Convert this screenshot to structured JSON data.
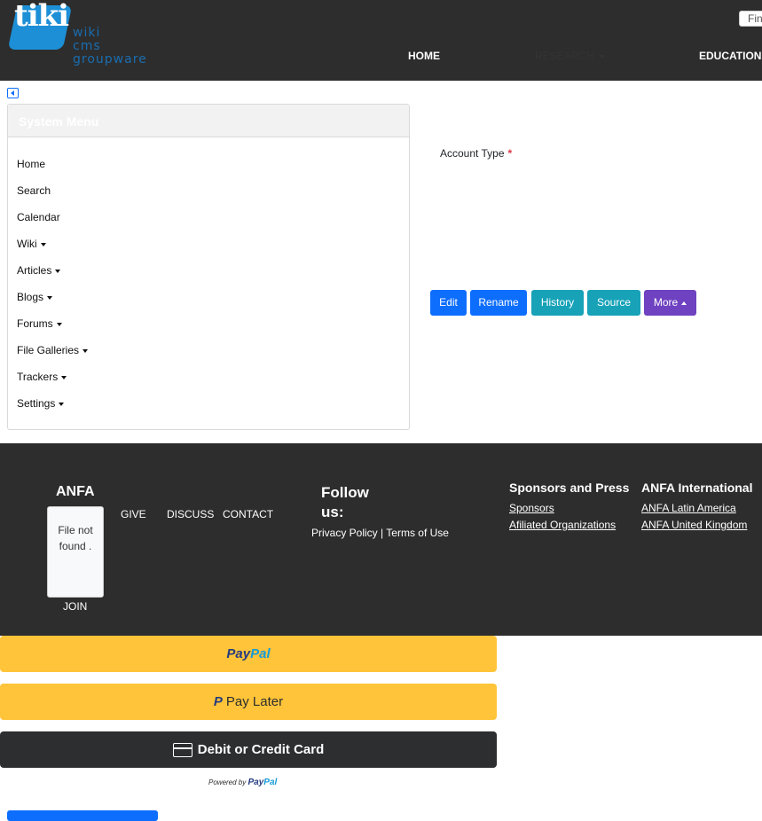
{
  "header": {
    "logo": "tiki",
    "logo_subtitle_lines": [
      "wiki",
      "cms",
      "groupware"
    ],
    "nav": {
      "home": "HOME",
      "research": "RESEARCH",
      "education": "EDUCATION"
    },
    "find_placeholder": "Fin"
  },
  "system_menu": {
    "title": "System Menu",
    "items": [
      {
        "label": "Home"
      },
      {
        "label": "Search"
      },
      {
        "label": "Calendar"
      },
      {
        "label": "Wiki"
      },
      {
        "label": "Articles"
      },
      {
        "label": "Blogs"
      },
      {
        "label": "Forums"
      },
      {
        "label": "File Galleries"
      },
      {
        "label": "Trackers"
      },
      {
        "label": "Settings"
      }
    ]
  },
  "content": {
    "account_type_label": "Account Type",
    "required_mark": "*",
    "buttons": {
      "edit": "Edit",
      "rename": "Rename",
      "history": "History",
      "source": "Source",
      "more": "More"
    }
  },
  "footer": {
    "anfa": "ANFA",
    "file_not_found": "File not found .",
    "join": "JOIN",
    "give": "GIVE",
    "discuss": "DISCUSS",
    "contact": "CONTACT",
    "follow_us": "Follow us:",
    "privacy_policy": "Privacy Policy",
    "separator": "|",
    "terms_of_use": "Terms of Use",
    "sponsors_heading": "Sponsors and Press",
    "sponsors": "Sponsors",
    "affiliated": "Afiliated Organizations",
    "international_heading": "ANFA International",
    "latin_america": "ANFA Latin America",
    "united_kingdom": "ANFA United Kingdom"
  },
  "paypal": {
    "paypal_pay": "Pay",
    "paypal_pal": "Pal",
    "pay_later": "Pay Later",
    "debit_credit": "Debit or Credit Card",
    "powered_by": "Powered by",
    "powered_pay": "Pay",
    "powered_pal": "Pal"
  },
  "colors": {
    "primary": "#0d6efd",
    "info": "#17a2b8",
    "purple": "#6f42c1",
    "paypal_gold": "#ffc439",
    "footer_bg": "#2d2d2d"
  }
}
